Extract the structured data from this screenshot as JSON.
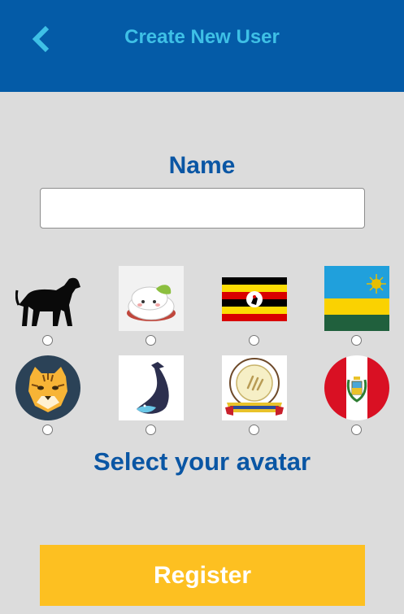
{
  "header": {
    "title": "Create New User",
    "back_icon": "chevron-left-icon",
    "background_color": "#045ba7",
    "title_color": "#3ec0e6"
  },
  "form": {
    "name_label": "Name",
    "name_value": "",
    "name_placeholder": "",
    "avatar_label": "Select your avatar",
    "register_label": "Register"
  },
  "avatars": [
    {
      "name": "dog",
      "selected": false
    },
    {
      "name": "cat-with-leaf",
      "selected": false
    },
    {
      "name": "uganda-flag",
      "selected": false
    },
    {
      "name": "rwanda-flag",
      "selected": false
    },
    {
      "name": "tiger",
      "selected": false
    },
    {
      "name": "whale",
      "selected": false
    },
    {
      "name": "venezuela-emblem",
      "selected": false
    },
    {
      "name": "peru-flag",
      "selected": false
    }
  ],
  "colors": {
    "accent_text": "#0a56a4",
    "register_button": "#fdc021",
    "background": "#dcdcdc"
  }
}
